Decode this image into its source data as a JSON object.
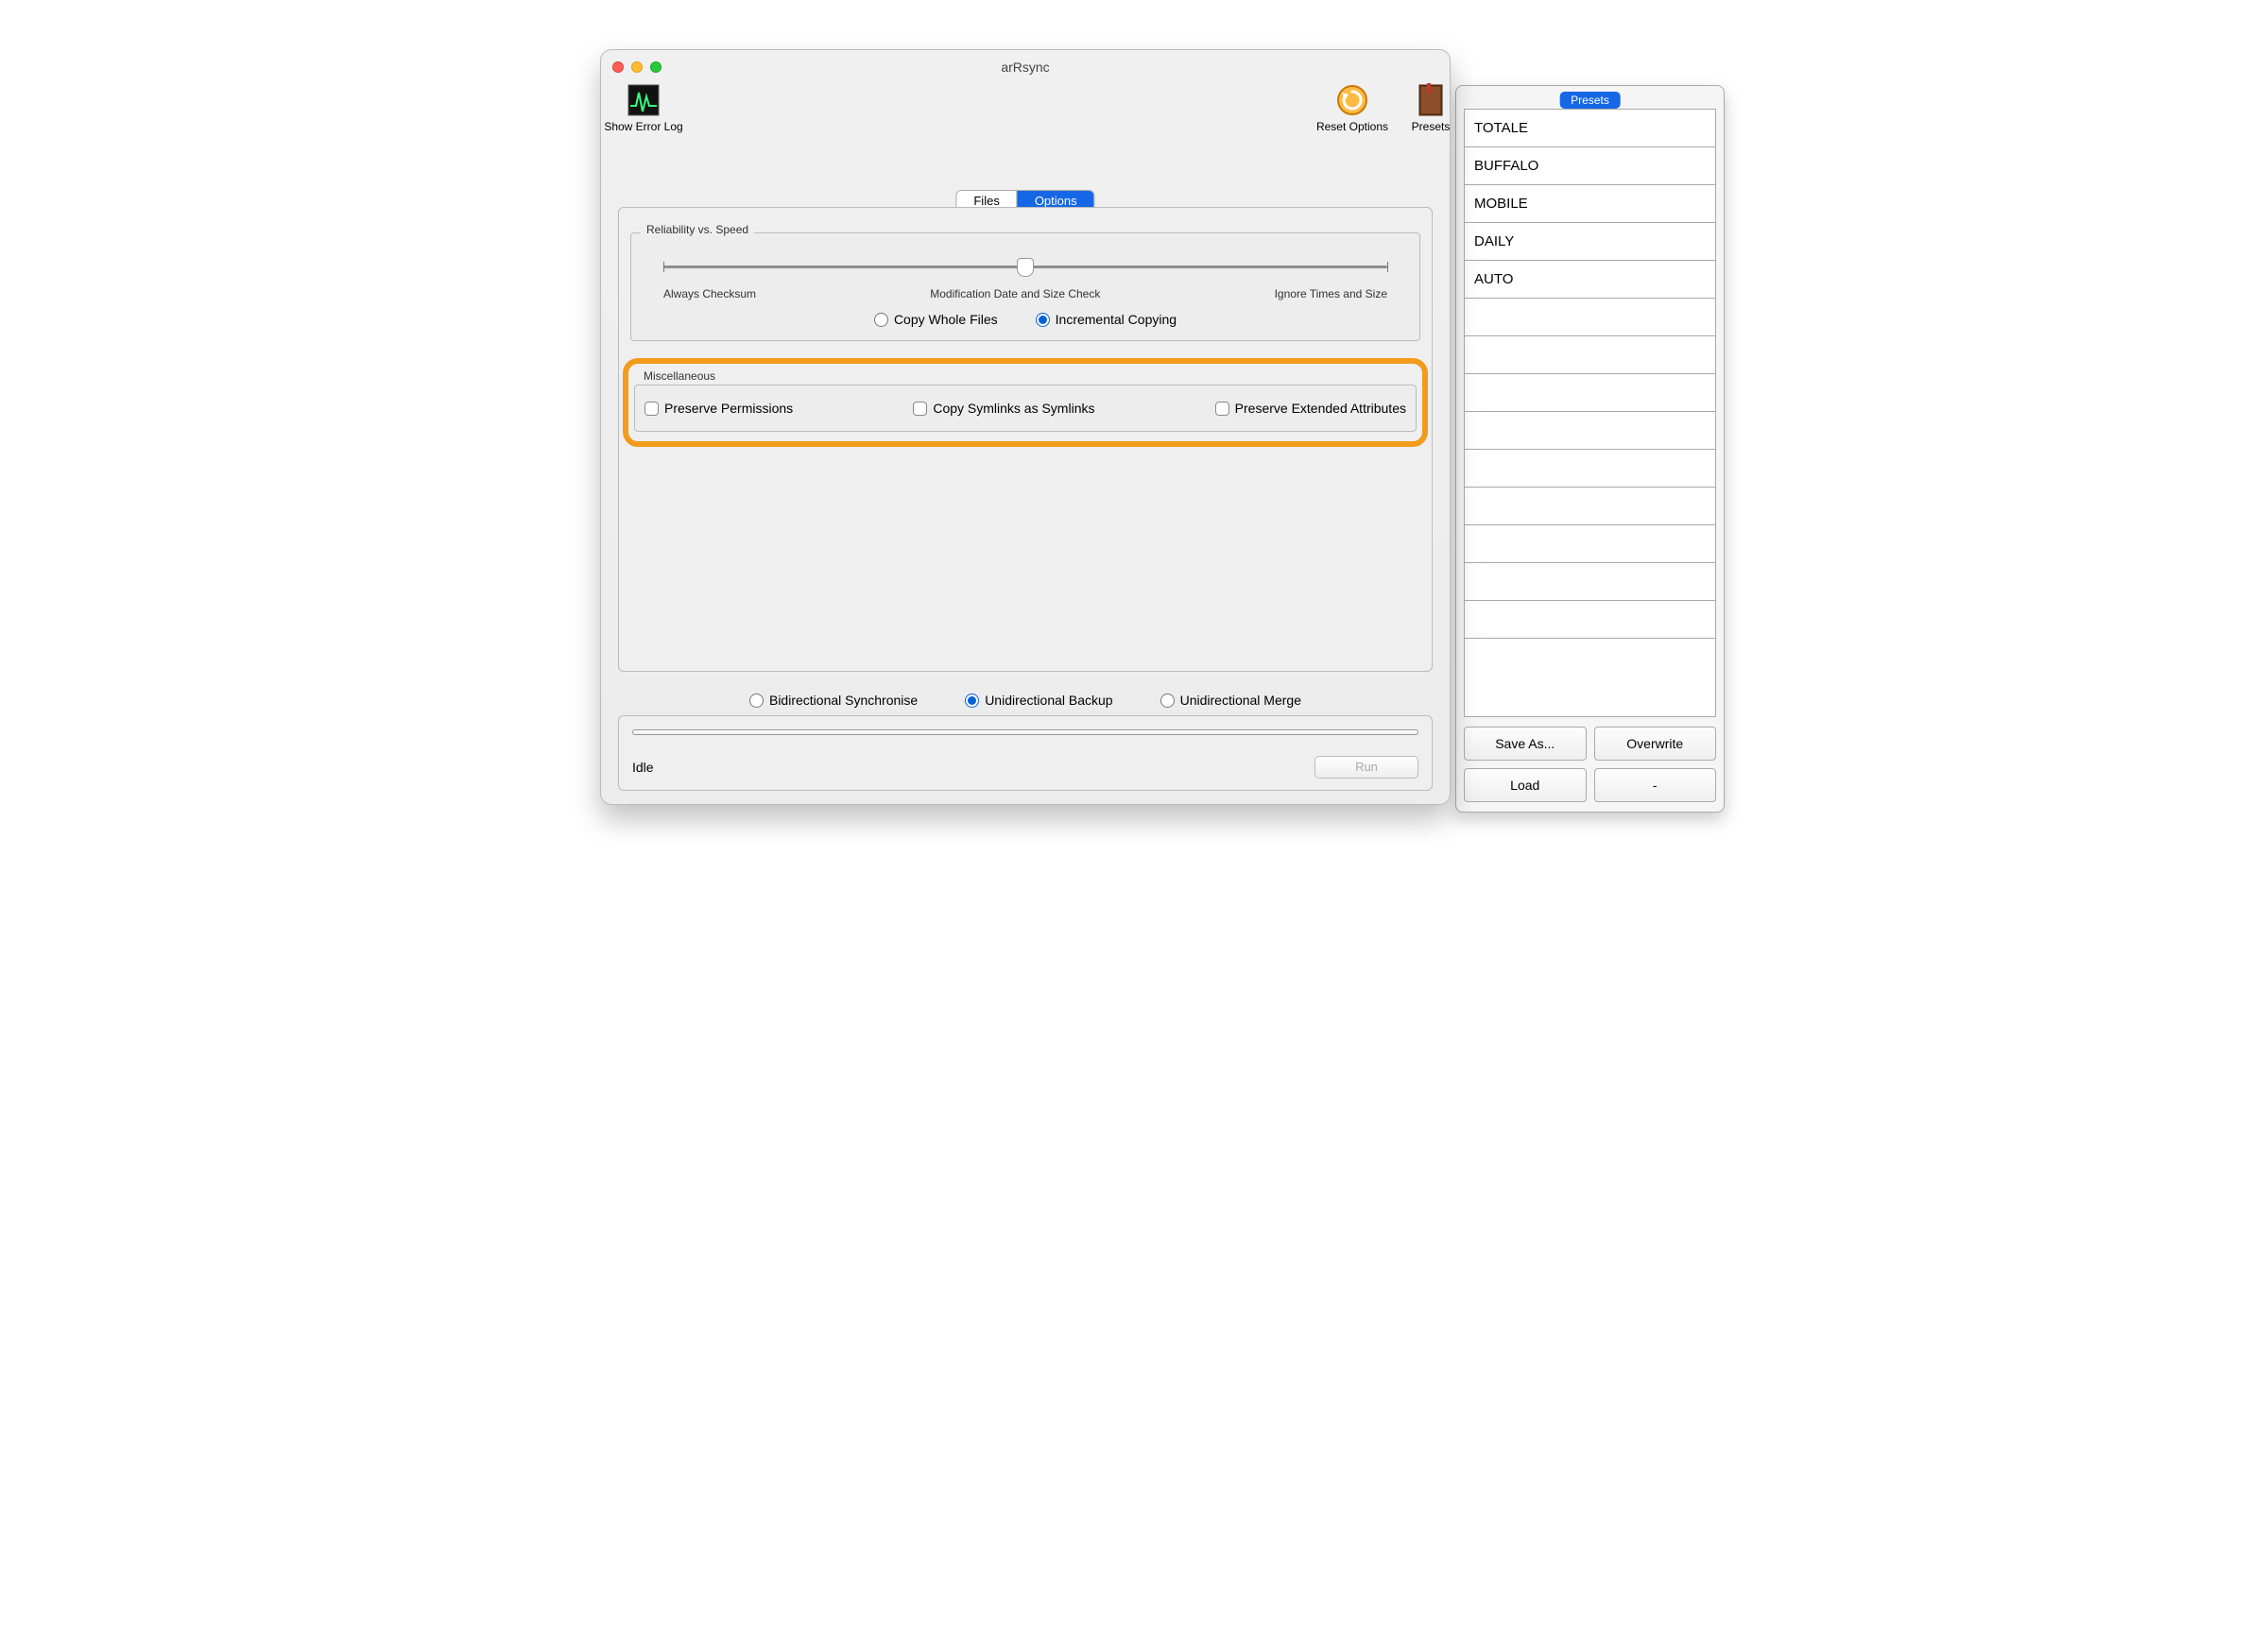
{
  "window": {
    "title": "arRsync"
  },
  "toolbar": {
    "show_error_log_label": "Show Error Log",
    "reset_options_label": "Reset Options",
    "presets_label": "Presets"
  },
  "tabs": {
    "files": "Files",
    "options": "Options",
    "active": "options"
  },
  "reliability_group": {
    "title": "Reliability vs. Speed",
    "left_label": "Always Checksum",
    "mid_label": "Modification Date and Size Check",
    "right_label": "Ignore Times and Size",
    "slider_value_pct": 50
  },
  "copy_mode": {
    "whole_files": "Copy Whole Files",
    "incremental": "Incremental Copying",
    "selected": "incremental"
  },
  "misc_group": {
    "title": "Miscellaneous",
    "preserve_permissions": "Preserve Permissions",
    "copy_symlinks": "Copy Symlinks as Symlinks",
    "preserve_xattrs": "Preserve Extended Attributes",
    "checked": {
      "preserve_permissions": false,
      "copy_symlinks": false,
      "preserve_xattrs": false
    }
  },
  "sync_mode": {
    "bidirectional": "Bidirectional Synchronise",
    "uni_backup": "Unidirectional Backup",
    "uni_merge": "Unidirectional Merge",
    "selected": "uni_backup"
  },
  "status": {
    "text": "Idle",
    "run_label": "Run",
    "run_enabled": false
  },
  "presets_panel": {
    "title": "Presets",
    "items": [
      "TOTALE",
      "BUFFALO",
      "MOBILE",
      "DAILY",
      "AUTO"
    ],
    "visible_rows": 15,
    "buttons": {
      "save_as": "Save As...",
      "overwrite": "Overwrite",
      "load": "Load",
      "dash": "-"
    }
  },
  "highlight_color": "#f29b1c"
}
